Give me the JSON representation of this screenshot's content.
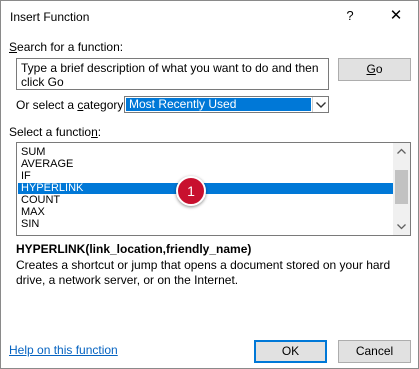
{
  "window": {
    "title": "Insert Function",
    "help_glyph": "?",
    "close_glyph": "✕"
  },
  "search": {
    "label_key": "S",
    "label_rest": "earch for a function:",
    "value": "Type a brief description of what you want to do and then click Go",
    "go_key": "G",
    "go_rest": "o"
  },
  "category": {
    "label_pre": "Or select a ",
    "label_key": "c",
    "label_post": "ategory:",
    "selected": "Most Recently Used"
  },
  "functions": {
    "label_pre": "Select a functio",
    "label_key": "n",
    "label_post": ":",
    "items": [
      "SUM",
      "AVERAGE",
      "IF",
      "HYPERLINK",
      "COUNT",
      "MAX",
      "SIN"
    ],
    "selected_index": 3
  },
  "marker": {
    "label": "1",
    "color": "#c8102e"
  },
  "details": {
    "syntax": "HYPERLINK(link_location,friendly_name)",
    "description": "Creates a shortcut or jump that opens a document stored on your hard drive, a network server, or on the Internet."
  },
  "footer": {
    "help_link": "Help on this function",
    "ok": "OK",
    "cancel": "Cancel"
  },
  "colors": {
    "selection": "#0078d7",
    "link": "#0563c1",
    "button_face": "#e1e1e1"
  }
}
